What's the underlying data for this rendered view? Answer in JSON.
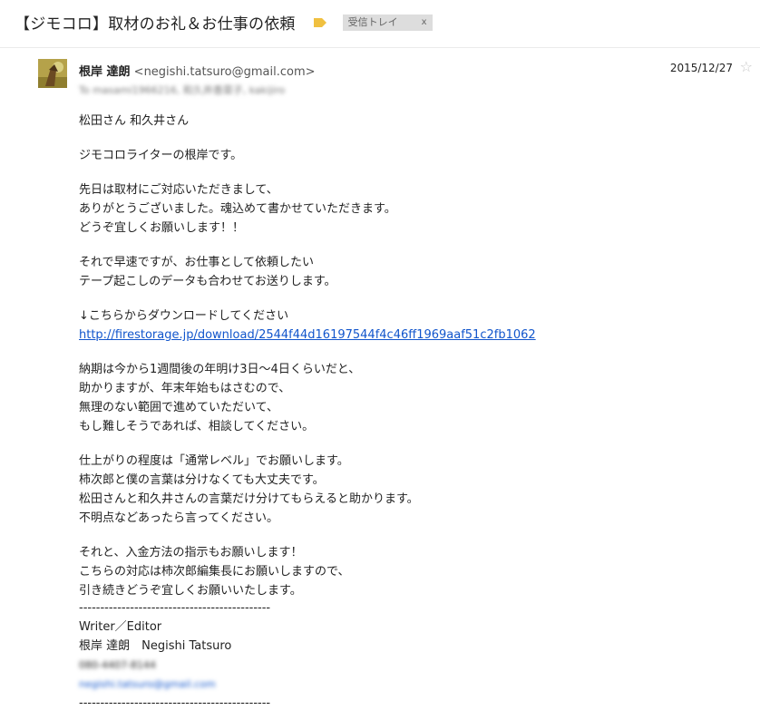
{
  "header": {
    "subject": "【ジモコロ】取材のお礼＆お仕事の依頼",
    "label": "受信トレイ",
    "label_remove": "x",
    "colors": {
      "important_marker": "#f0c040",
      "label_bg": "#dddddd"
    }
  },
  "message": {
    "sender_name": "根岸 達朗",
    "sender_email": "<negishi.tatsuro@gmail.com>",
    "to_line": "To masami1966216, 和久井香菜子, kakijiro",
    "date": "2015/12/27",
    "star": "☆"
  },
  "body": {
    "greeting": "松田さん 和久井さん",
    "intro": "ジモコロライターの根岸です。",
    "p1": [
      "先日は取材にご対応いただきまして、",
      "ありがとうございました。魂込めて書かせていただきます。",
      "どうぞ宜しくお願いします！！"
    ],
    "p2": [
      "それで早速ですが、お仕事として依頼したい",
      "テープ起こしのデータも合わせてお送りします。"
    ],
    "download_note": "↓こちらからダウンロードしてください",
    "download_link": "http://firestorage.jp/download/2544f44d16197544f4c46ff1969aaf51c2fb1062",
    "p4": [
      "納期は今から1週間後の年明け3日〜4日くらいだと、",
      "助かりますが、年末年始もはさむので、",
      "無理のない範囲で進めていただいて、",
      "もし難しそうであれば、相談してください。"
    ],
    "p5": [
      "仕上がりの程度は「通常レベル」でお願いします。",
      "柿次郎と僕の言葉は分けなくても大丈夫です。",
      "松田さんと和久井さんの言葉だけ分けてもらえると助かります。",
      "不明点などあったら言ってください。"
    ],
    "p6": [
      "それと、入金方法の指示もお願いします！",
      "こちらの対応は柿次郎編集長にお願いしますので、",
      "引き続きどうぞ宜しくお願いいたします。"
    ]
  },
  "signature": {
    "rule": "---------------------------------------------",
    "title": "Writer／Editor",
    "name": "根岸 達朗　Negishi Tatsuro",
    "phone": "080-4407-8144",
    "email": "negishi.tatsuro@gmail.com"
  }
}
